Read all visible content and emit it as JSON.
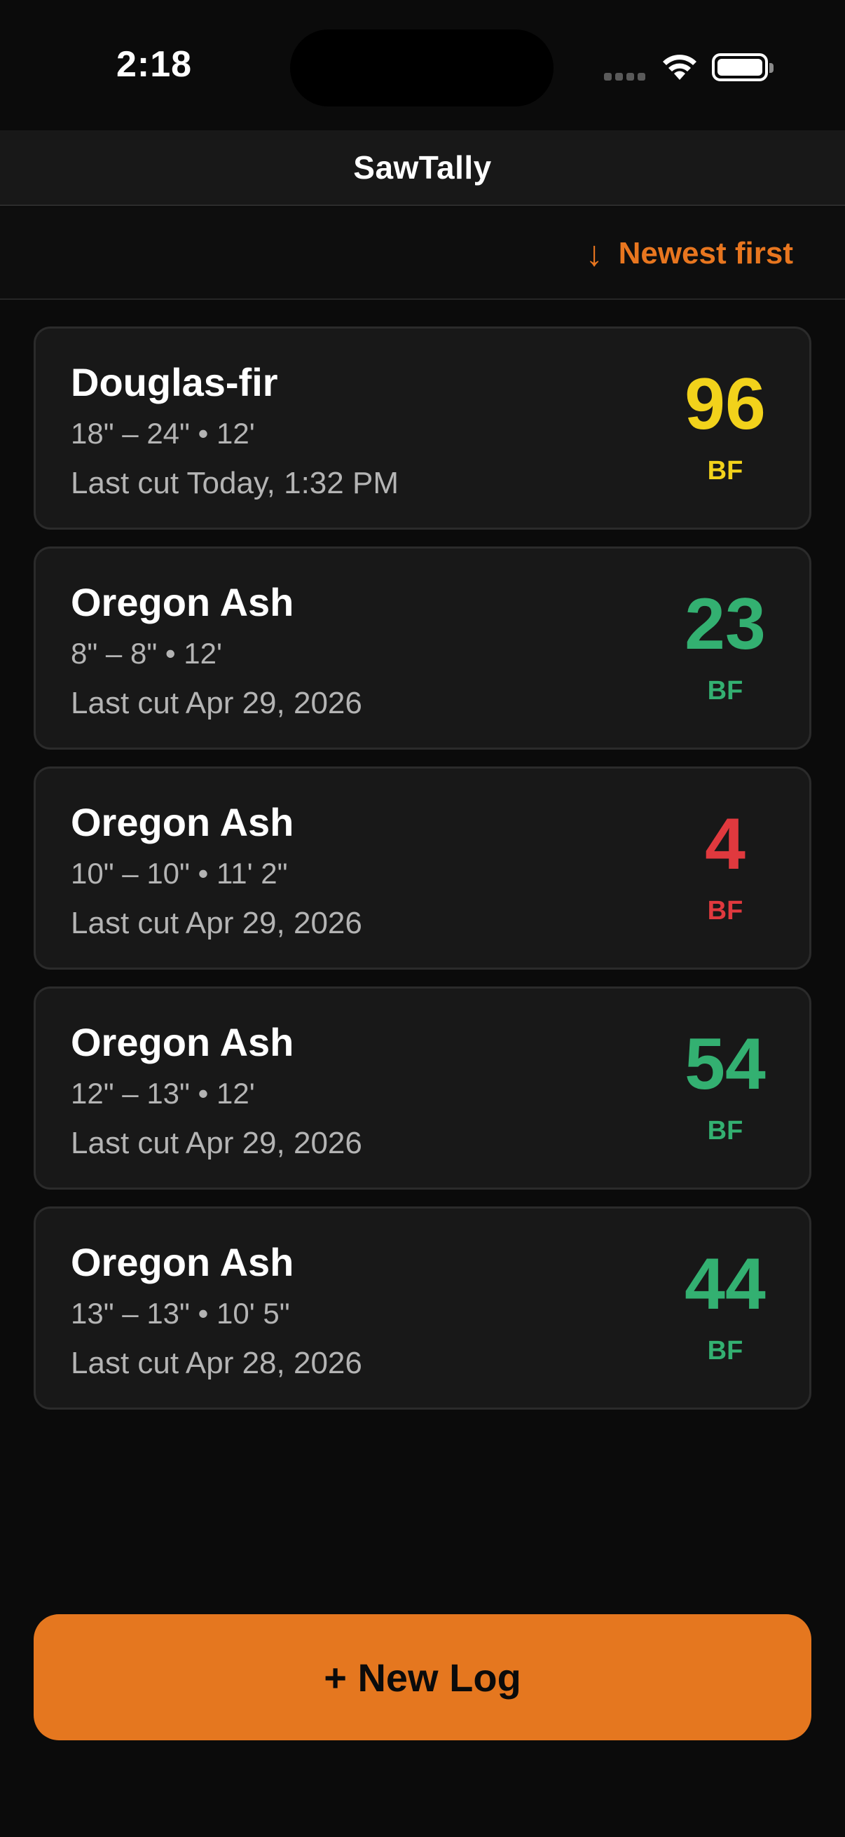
{
  "status_bar": {
    "time": "2:18",
    "icons": [
      "signal-icon",
      "wifi-icon",
      "battery-icon"
    ]
  },
  "nav": {
    "title": "SawTally"
  },
  "sort": {
    "icon": "arrow-down-icon",
    "label": "Newest first",
    "color": "#e8761f"
  },
  "colors": {
    "high": "#f2d21b",
    "good": "#33b071",
    "low": "#e0393e",
    "accent": "#e5771f"
  },
  "logs": [
    {
      "species": "Douglas-fir",
      "dims": "18\" – 24\"  •  12'",
      "last_cut": "Last cut Today, 1:32 PM",
      "bf": "96",
      "bf_unit": "BF",
      "color": "#f2d21b"
    },
    {
      "species": "Oregon Ash",
      "dims": "8\" – 8\"  •  12'",
      "last_cut": "Last cut Apr 29, 2026",
      "bf": "23",
      "bf_unit": "BF",
      "color": "#33b071"
    },
    {
      "species": "Oregon Ash",
      "dims": "10\" – 10\"  •  11' 2\"",
      "last_cut": "Last cut Apr 29, 2026",
      "bf": "4",
      "bf_unit": "BF",
      "color": "#e0393e"
    },
    {
      "species": "Oregon Ash",
      "dims": "12\" – 13\"  •  12'",
      "last_cut": "Last cut Apr 29, 2026",
      "bf": "54",
      "bf_unit": "BF",
      "color": "#33b071"
    },
    {
      "species": "Oregon Ash",
      "dims": "13\" – 13\"  •  10' 5\"",
      "last_cut": "Last cut Apr 28, 2026",
      "bf": "44",
      "bf_unit": "BF",
      "color": "#33b071"
    }
  ],
  "actions": {
    "new_log_label": "+ New Log"
  }
}
